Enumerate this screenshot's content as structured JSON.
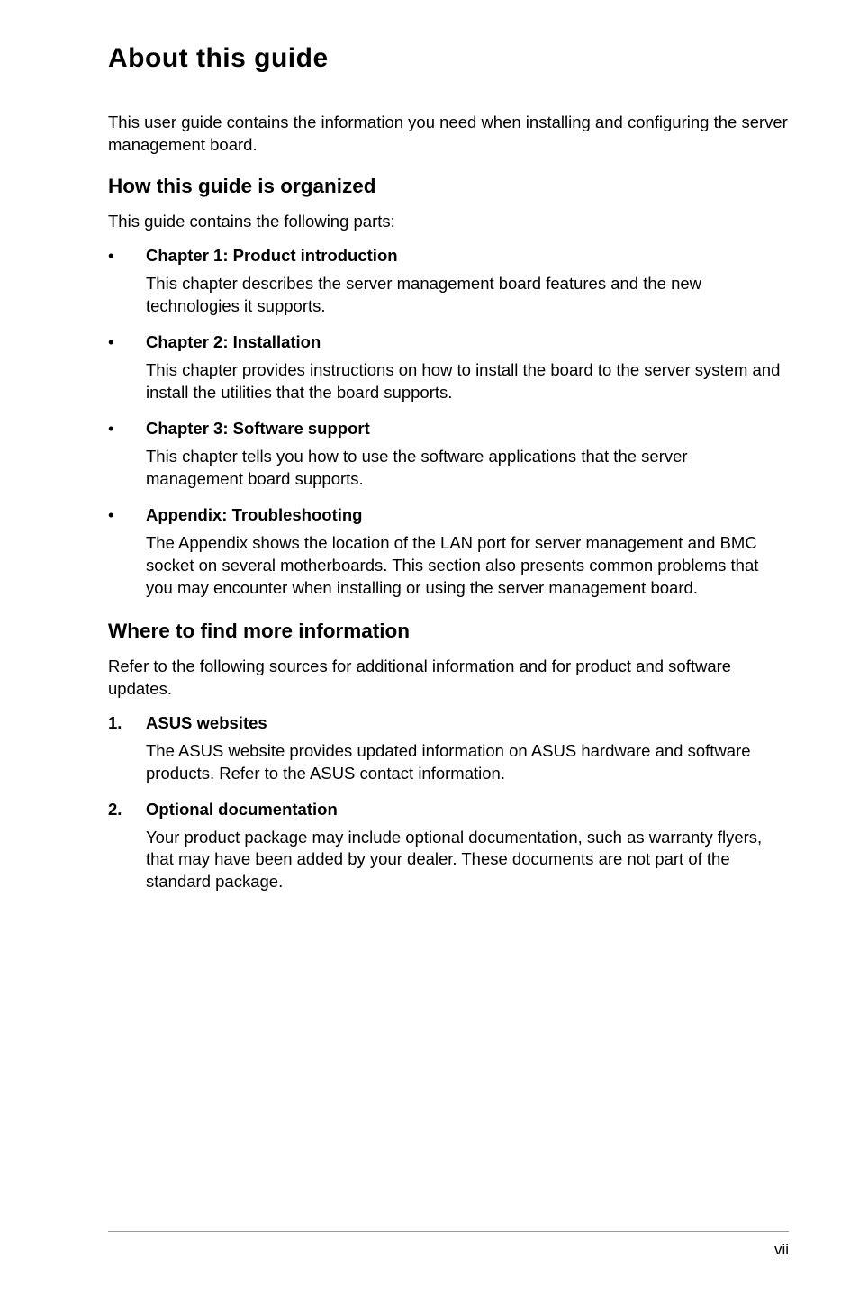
{
  "title": "About this guide",
  "intro": "This user guide contains the information you need when installing and configuring the server management board.",
  "section1": {
    "heading": "How this guide is organized",
    "intro": "This guide contains the following parts:",
    "items": [
      {
        "title": "Chapter 1: Product introduction",
        "body": "This chapter describes the server management board features and the new technologies it supports."
      },
      {
        "title": "Chapter 2: Installation",
        "body": "This chapter provides instructions on how to install the board to the server system and install the utilities that the board supports."
      },
      {
        "title": "Chapter 3: Software support",
        "body": "This chapter tells you how to use the software applications that the server management board supports."
      },
      {
        "title": "Appendix: Troubleshooting",
        "body": "The Appendix shows the location of the LAN port for server management and BMC socket on several motherboards. This section also presents common problems that you may encounter when installing or using the server management board."
      }
    ]
  },
  "section2": {
    "heading": "Where to find more information",
    "intro": "Refer to the following sources for additional information and for product and software updates.",
    "items": [
      {
        "num": "1.",
        "title": "ASUS websites",
        "body": "The ASUS website provides updated information on ASUS hardware and software products. Refer to the ASUS contact information."
      },
      {
        "num": "2.",
        "title": "Optional documentation",
        "body": "Your product package may include optional documentation, such as warranty flyers, that may have been added by your dealer. These documents are not part of the standard package."
      }
    ]
  },
  "page_number": "vii",
  "bullet": "•"
}
